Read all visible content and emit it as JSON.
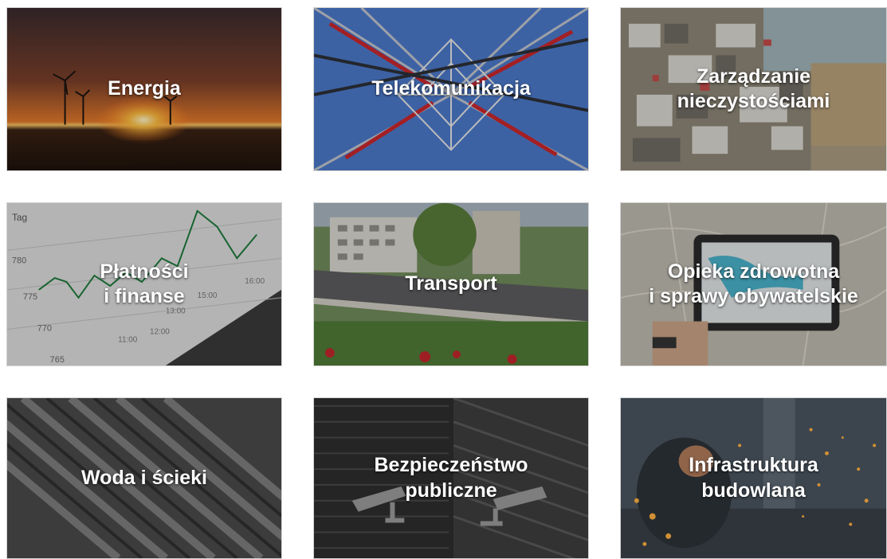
{
  "tiles": [
    {
      "lines": [
        "Energia"
      ]
    },
    {
      "lines": [
        "Telekomunikacja"
      ]
    },
    {
      "lines": [
        "Zarządzanie",
        "nieczystościami"
      ]
    },
    {
      "lines": [
        "Płatności",
        "i finanse"
      ]
    },
    {
      "lines": [
        "Transport"
      ]
    },
    {
      "lines": [
        "Opieka zdrowotna",
        "i sprawy obywatelskie"
      ]
    },
    {
      "lines": [
        "Woda i ścieki"
      ]
    },
    {
      "lines": [
        "Bezpieczeństwo",
        "publiczne"
      ]
    },
    {
      "lines": [
        "Infrastruktura",
        "budowlana"
      ]
    }
  ],
  "chart_text": {
    "tag": "Tag",
    "y_labels": [
      "780",
      "775",
      "770",
      "765"
    ],
    "x_labels": [
      "11:00",
      "12:00",
      "13:00",
      "15:00",
      "16:00"
    ]
  },
  "icons": [
    "wind-turbine-icon",
    "cctv-camera-icon"
  ]
}
